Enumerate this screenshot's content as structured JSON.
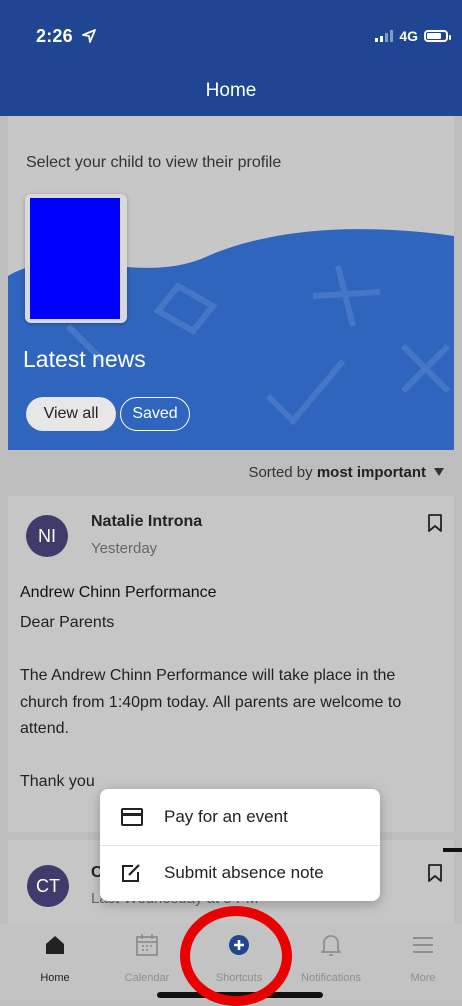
{
  "status_bar": {
    "time": "2:26",
    "network": "4G"
  },
  "header": {
    "title": "Home"
  },
  "children": {
    "prompt": "Select your child to view their profile"
  },
  "news": {
    "title": "Latest news",
    "view_all_label": "View all",
    "saved_label": "Saved"
  },
  "sort": {
    "prefix": "Sorted by",
    "value": "most important"
  },
  "posts": [
    {
      "avatar": "NI",
      "author": "Natalie Introna",
      "time": "Yesterday",
      "title": "Andrew Chinn Performance",
      "body": "Dear Parents\n\nThe Andrew Chinn Performance will take place in the church from 1:40pm today.  All parents are welcome to attend.\n\nThank you"
    },
    {
      "avatar": "CT",
      "author": "C",
      "time": "Last Wednesday at 5 PM"
    }
  ],
  "shortcuts_menu": {
    "items": [
      {
        "label": "Pay for an event",
        "icon": "card-icon"
      },
      {
        "label": "Submit absence note",
        "icon": "edit-note-icon"
      }
    ]
  },
  "tab_bar": {
    "tabs": [
      {
        "label": "Home",
        "icon": "home-icon",
        "active": true
      },
      {
        "label": "Calendar",
        "icon": "calendar-icon",
        "active": false
      },
      {
        "label": "Shortcuts",
        "icon": "plus-circle-icon",
        "active": false
      },
      {
        "label": "Notifications",
        "icon": "bell-icon",
        "active": false
      },
      {
        "label": "More",
        "icon": "menu-icon",
        "active": false
      }
    ]
  },
  "colors": {
    "brand": "#1f4593",
    "hero_blue": "#2f65bd",
    "avatar": "#3f3b6c",
    "highlight": "#ea0000"
  }
}
